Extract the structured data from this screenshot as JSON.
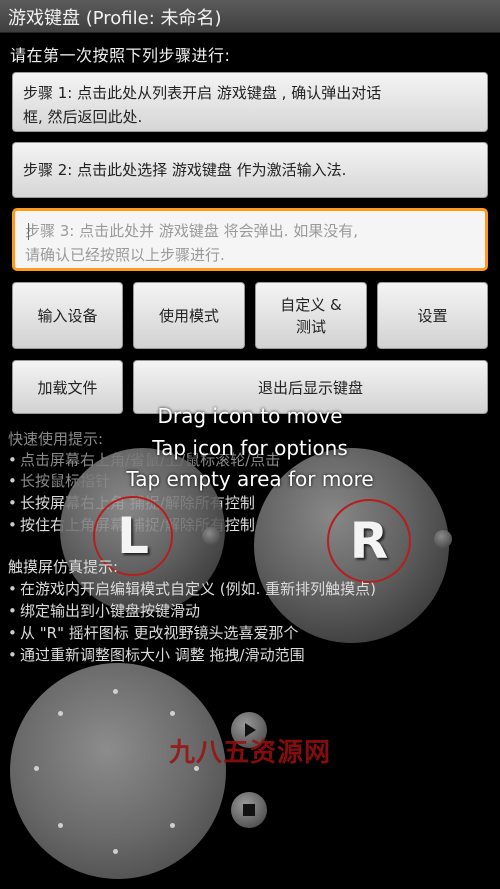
{
  "title": "游戏键盘 (Profile: 未命名)",
  "intro": "请在第一次按照下列步骤进行:",
  "steps": [
    {
      "line1": "步骤 1: 点击此处从列表开启 游戏键盘 , 确认弹出对话",
      "line2": "框, 然后返回此处."
    },
    {
      "text": "步骤 2: 点击此处选择 游戏键盘 作为激活输入法."
    },
    {
      "line1": "步骤 3: 点击此处并 游戏键盘 将会弹出. 如果没有,",
      "line2": "请确认已经按照以上步骤进行."
    }
  ],
  "buttons": {
    "input_device": "输入设备",
    "use_mode": "使用模式",
    "custom_line1": "自定义 &",
    "custom_line2": "测试",
    "settings": "设置",
    "load_file": "加载文件",
    "show_keyboard_after_exit": "退出后显示键盘"
  },
  "quick": {
    "header": "快速使用提示:",
    "items": [
      "点击屏幕右上角/省鼠/上/鼠标滚轮/点击",
      "长按鼠标指针",
      "长按屏幕右上角 捕捉/解除所有控制",
      "按住右上角屏幕 捕捉/解除所有控制"
    ]
  },
  "touch": {
    "header": "触摸屏仿真提示:",
    "items": [
      "在游戏内开启编辑模式自定义 (例如. 重新排列触摸点)",
      "绑定输出到小键盘按键滑动",
      "从 \"R\" 摇杆图标 更改视野镜头选喜爱那个",
      "通过重新调整图标大小 调整 拖拽/滑动范围"
    ]
  },
  "overlay": {
    "drag": "Drag icon to move",
    "tap": "Tap icon for options",
    "tap_empty": "Tap empty area for more"
  },
  "joysticks": {
    "left_label": "L",
    "right_label": "R"
  },
  "icons": [
    "play-icon",
    "stop-icon"
  ],
  "watermark": "九八五资源网",
  "colors": {
    "accent": "#ff9a1a",
    "ring": "#b81d1d"
  }
}
